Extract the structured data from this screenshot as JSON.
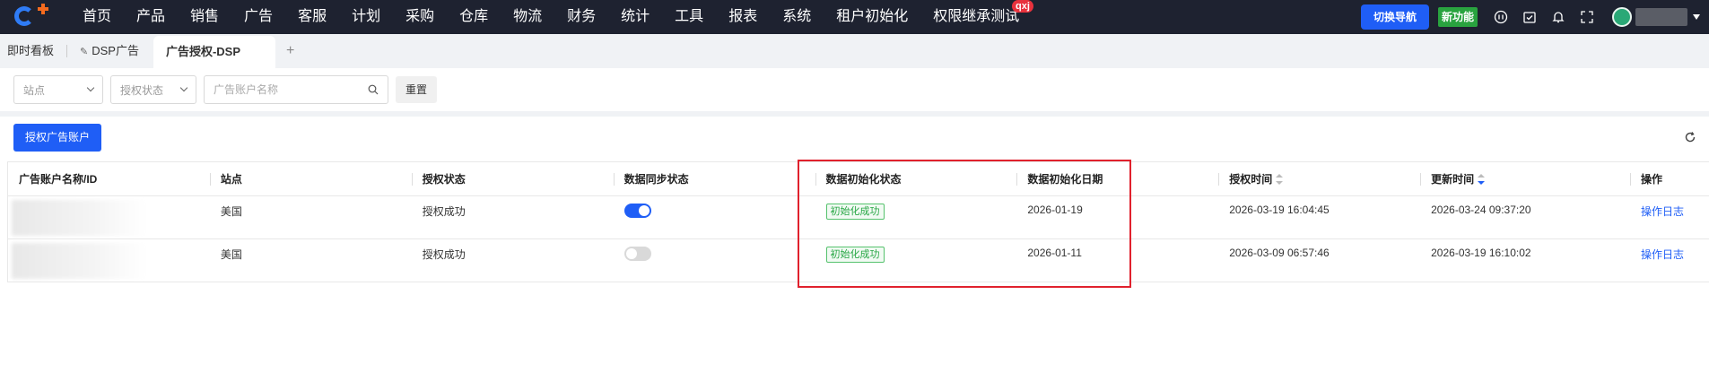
{
  "topnav": {
    "menu": [
      "首页",
      "产品",
      "销售",
      "广告",
      "客服",
      "计划",
      "采购",
      "仓库",
      "物流",
      "财务",
      "统计",
      "工具",
      "报表",
      "系统",
      "租户初始化",
      "权限继承测试"
    ],
    "badge": "qxj",
    "switch_nav_label": "切换导航",
    "new_feature_label": "新功能"
  },
  "tabs": {
    "items": [
      "即时看板",
      "DSP广告",
      "广告授权-DSP"
    ],
    "add": "+"
  },
  "filters": {
    "site_placeholder": "站点",
    "auth_status_placeholder": "授权状态",
    "account_name_placeholder": "广告账户名称",
    "reset_label": "重置"
  },
  "toolbar": {
    "authorize_label": "授权广告账户"
  },
  "table": {
    "columns": [
      "广告账户名称/ID",
      "站点",
      "授权状态",
      "数据同步状态",
      "数据初始化状态",
      "数据初始化日期",
      "授权时间",
      "更新时间",
      "操作"
    ],
    "rows": [
      {
        "site": "美国",
        "auth_status": "授权成功",
        "sync_on": true,
        "init_status": "初始化成功",
        "init_date": "2026-01-19",
        "auth_time": "2026-03-19 16:04:45",
        "update_time": "2026-03-24 09:37:20",
        "action": "操作日志"
      },
      {
        "site": "美国",
        "auth_status": "授权成功",
        "sync_on": false,
        "init_status": "初始化成功",
        "init_date": "2026-01-11",
        "auth_time": "2026-03-09 06:57:46",
        "update_time": "2026-03-19 16:10:02",
        "action": "操作日志"
      }
    ]
  },
  "colors": {
    "topbar": "#1e2230",
    "primary": "#1f5ef6",
    "success": "#28a745",
    "highlight": "#e0212d"
  }
}
